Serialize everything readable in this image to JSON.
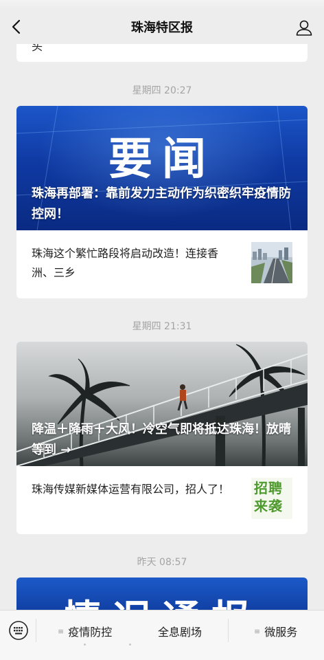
{
  "header": {
    "title": "珠海特区报",
    "back_icon": "chevron-left-icon",
    "profile_icon": "user-icon"
  },
  "feed": [
    {
      "timestamp": "星期四 20:27",
      "hero": {
        "overlay_text": "要闻",
        "caption": "珠海再部署：靠前发力主动作为织密织牢疫情防控网！"
      },
      "item": {
        "title": "珠海这个繁忙路段将启动改造！连接香洲、三乡"
      }
    },
    {
      "timestamp": "星期四 21:31",
      "hero": {
        "caption": "降温＋降雨＋大风！冷空气即将抵达珠海！放晴等到 →"
      },
      "item": {
        "title": "珠海传媒新媒体运营有限公司，招人了！",
        "thumb_text": "招聘来袭"
      }
    },
    {
      "timestamp": "昨天 08:57",
      "hero": {
        "overlay_text": "情况通报"
      }
    }
  ],
  "partial_card_text": "头",
  "bottom_bar": {
    "keyboard_icon": "keyboard-icon",
    "menus": [
      {
        "label": "疫情防控",
        "has_submenu": true
      },
      {
        "label": "全息剧场",
        "has_submenu": false
      },
      {
        "label": "微服务",
        "has_submenu": true
      }
    ]
  },
  "colors": {
    "background": "#ededed",
    "card": "#ffffff",
    "news_banner": "#1a4fc0",
    "recruit_green": "#4e9a2e"
  }
}
